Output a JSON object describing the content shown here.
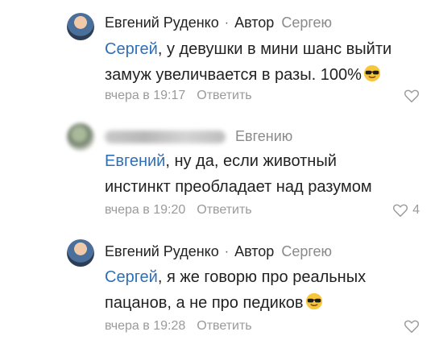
{
  "comments": [
    {
      "author": "Евгений Руденко",
      "dot": "·",
      "badge": "Автор",
      "reply_to": "Сергею",
      "mention": "Сергей",
      "text_line1_rest": ", у девушки в мини шанс выйти",
      "text_line2": "замуж увеличвается в разы. 100%",
      "time": "вчера в 19:17",
      "reply_label": "Ответить",
      "emoji": "sunglasses-emoji"
    },
    {
      "author": "",
      "reply_to": "Евгению",
      "mention": "Евгений",
      "text_line1_rest": ", ну да, если животный",
      "text_line2": "инстинкт преобладает над разумом",
      "time": "вчера в 19:20",
      "reply_label": "Ответить",
      "likes": "4"
    },
    {
      "author": "Евгений Руденко",
      "dot": "·",
      "badge": "Автор",
      "reply_to": "Сергею",
      "mention": "Сергей",
      "text_line1_rest": ", я же говорю про реальных",
      "text_line2": "пацанов, а не про педиков",
      "time": "вчера в 19:28",
      "reply_label": "Ответить",
      "emoji": "sunglasses-emoji"
    }
  ],
  "colors": {
    "mention": "#2f6fb5",
    "muted": "#9a9a9a",
    "text": "#222222"
  }
}
